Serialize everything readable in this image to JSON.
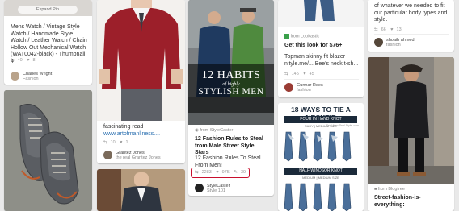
{
  "col1": {
    "expand_pin": "Expand Pin",
    "watch_pin": {
      "title": "Mens Watch / Vintage Style Watch / Handmade Style Watch / Leather Watch / Chain Hollow Out Mechanical Watch (WAT0042-black) - Thumbnail 4",
      "repins": "40",
      "likes": "8",
      "pinner_name": "Charles Wright",
      "pinner_board": "Fashion"
    }
  },
  "col2": {
    "sweater_pin": {
      "desc": "fascinating read",
      "link": "www.artofmanliness....",
      "repins": "10",
      "likes": "1",
      "pinner_name": "Grantez Jones",
      "pinner_board": "the real Grantez Jones"
    }
  },
  "col3": {
    "overlay_line1": "12 HABITS",
    "overlay_line2": "of highly",
    "overlay_line3": "STYLISH MEN",
    "pin": {
      "from_label": "from StyleCaster",
      "title": "12 Fashion Rules to Steal from Male Street Style Stars",
      "desc": "12 Fashion Rules To Steal From Men!",
      "repins": "2283",
      "likes": "975",
      "comments": "39",
      "pinner_name": "StyleCaster",
      "pinner_board": "Style 101",
      "highlight_color": "#c8102e"
    }
  },
  "col4": {
    "pin": {
      "from_label": "from Lookastic",
      "title": "Get this look for $76+",
      "desc": "Topman skinny fit blazer nityle.me/... Bee's neck t-sh...",
      "repins": "145",
      "likes": "45",
      "pinner_name": "Gunnar Rees",
      "pinner_board": "fashion"
    },
    "necktie": {
      "title": "18 WAYS TO TIE A NECKTIE",
      "knot1": "FOUR IN HAND KNOT",
      "knot1_sub": "EASY | MEDIUM SIZE",
      "knot2": "HALF WINDSOR KNOT",
      "knot2_sub": "MEDIUM | MEDIUM SIZE",
      "brand": "Real Men Real Style .com"
    }
  },
  "col5": {
    "top_pin": {
      "desc": "of whatever we needed to fit our particular body types and style.",
      "repins": "66",
      "likes": "13",
      "pinner_name": "shoaib ahmed",
      "pinner_board": "fashion"
    },
    "bottom_pin": {
      "from_label": "from Blogfree",
      "title": "Street-fashion-is-everything:"
    }
  },
  "colors": {
    "background": "#e9e9e9",
    "highlight": "#c8102e",
    "link": "#2a6fb0"
  }
}
